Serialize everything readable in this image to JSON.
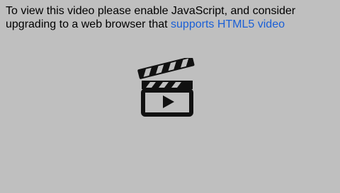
{
  "player": {
    "message_prefix": "To view this video please enable JavaScript, and consider upgrading to a web browser that ",
    "link_text": "supports HTML5 video",
    "icon": "clapperboard-play-icon",
    "background_color": "#bfbfbf",
    "link_color": "#1a5fd6"
  }
}
